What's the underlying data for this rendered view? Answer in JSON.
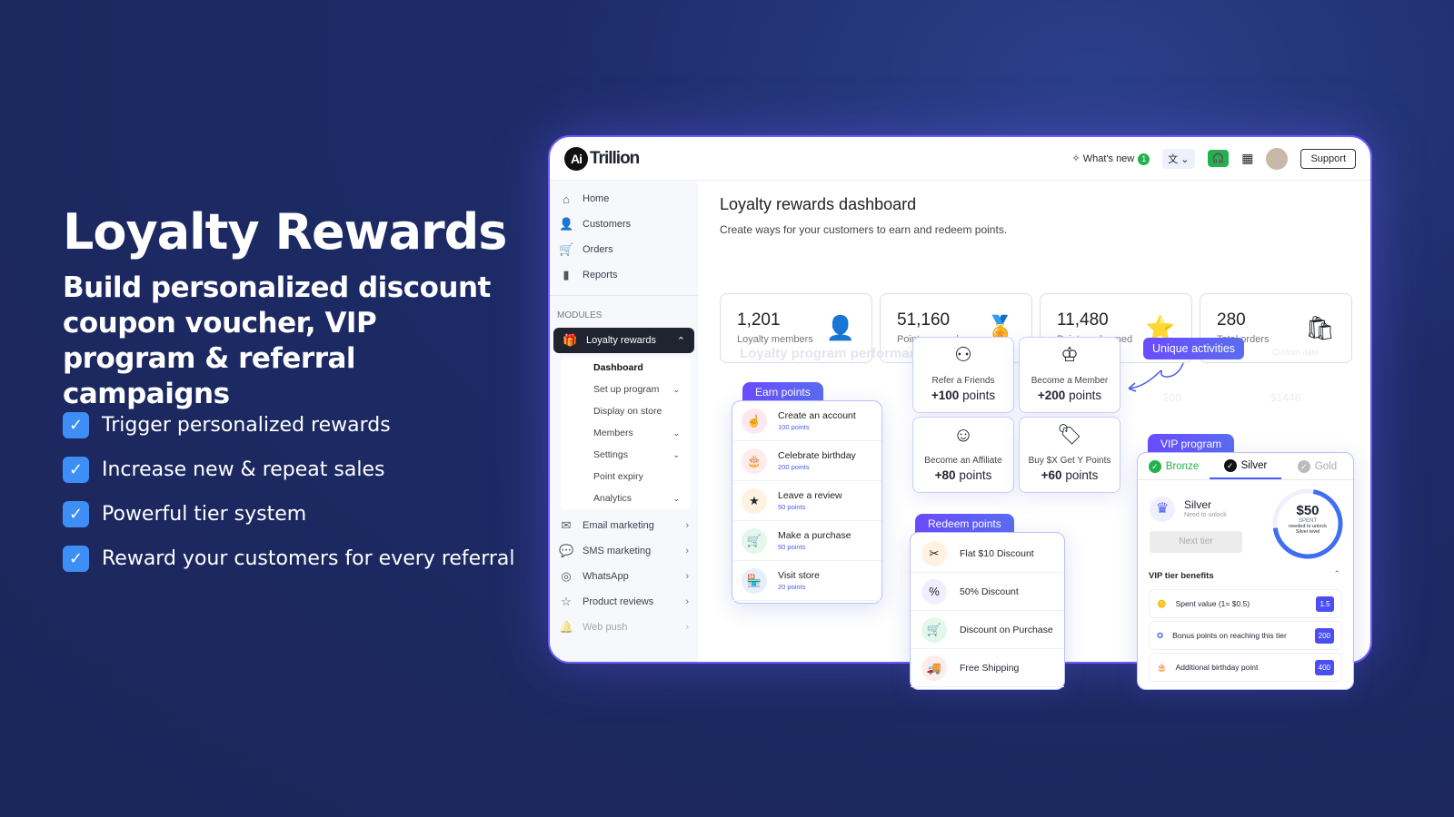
{
  "hero": {
    "title": "Loyalty Rewards",
    "subtitle": "Build personalized discount coupon voucher, VIP program & referral campaigns",
    "features": [
      "Trigger personalized rewards",
      "Increase new & repeat sales",
      "Powerful tier system",
      "Reward your customers for every referral"
    ]
  },
  "app": {
    "logo_mark": "Ai",
    "logo_text": "Trillion",
    "whats_new": "What's new",
    "whats_new_count": "1",
    "support": "Support",
    "colors": {
      "accent": "#6b4cff",
      "background": "#1d2b68",
      "green": "#22b14c"
    }
  },
  "sidebar": {
    "items": [
      {
        "label": "Home",
        "icon": "home-icon"
      },
      {
        "label": "Customers",
        "icon": "user-icon"
      },
      {
        "label": "Orders",
        "icon": "cart-icon"
      },
      {
        "label": "Reports",
        "icon": "bar-chart-icon"
      }
    ],
    "modules_label": "MODULES",
    "active": "Loyalty rewards",
    "sub": [
      {
        "label": "Dashboard",
        "chev": false
      },
      {
        "label": "Set up program",
        "chev": true
      },
      {
        "label": "Display on store",
        "chev": false
      },
      {
        "label": "Members",
        "chev": true
      },
      {
        "label": "Settings",
        "chev": true
      },
      {
        "label": "Point expiry",
        "chev": false
      },
      {
        "label": "Analytics",
        "chev": true
      }
    ],
    "modules": [
      {
        "label": "Email marketing",
        "icon": "mail-icon"
      },
      {
        "label": "SMS marketing",
        "icon": "sms-icon"
      },
      {
        "label": "WhatsApp",
        "icon": "whatsapp-icon"
      },
      {
        "label": "Product reviews",
        "icon": "star-icon"
      },
      {
        "label": "Web push",
        "icon": "bell-icon"
      }
    ]
  },
  "main": {
    "title": "Loyalty rewards dashboard",
    "subtitle": "Create ways for your customers to earn and redeem points.",
    "stats": [
      {
        "value": "1,201",
        "label": "Loyalty members"
      },
      {
        "value": "51,160",
        "label": "Points earned"
      },
      {
        "value": "11,480",
        "label": "Points redeemed"
      },
      {
        "value": "280",
        "label": "Total orders"
      }
    ],
    "faded_title": "Loyalty program performance",
    "faded_date": "Custom date",
    "faded_vals": [
      "200",
      "$1446"
    ]
  },
  "earn": {
    "tag": "Earn points",
    "items": [
      {
        "title": "Create an account",
        "points": "100 points"
      },
      {
        "title": "Celebrate birthday",
        "points": "200 points"
      },
      {
        "title": "Leave a review",
        "points": "50 points"
      },
      {
        "title": "Make a purchase",
        "points": "50 points"
      },
      {
        "title": "Visit store",
        "points": "20 points"
      }
    ]
  },
  "activities": {
    "tag": "Unique activities",
    "items": [
      {
        "title": "Refer a Friends",
        "bold": "+100",
        "rest": " points"
      },
      {
        "title": "Become a Member",
        "bold": "+200",
        "rest": " points"
      },
      {
        "title": "Become an Affiliate",
        "bold": "+80",
        "rest": " points"
      },
      {
        "title": "Buy $X Get Y Points",
        "bold": "+60",
        "rest": " points"
      }
    ]
  },
  "redeem": {
    "tag": "Redeem points",
    "items": [
      "Flat $10 Discount",
      "50% Discount",
      "Discount on Purchase",
      "Free Shipping"
    ]
  },
  "vip": {
    "tag": "VIP program",
    "tabs": [
      "Bronze",
      "Silver",
      "Gold"
    ],
    "tier": "Silver",
    "tier_sub": "Need to unlock",
    "next": "Next tier",
    "ring": {
      "amount": "$50",
      "spent": "SPENT",
      "line1": "needed to unlock",
      "line2": "Silver level",
      "progress": 0.7
    },
    "benefits_title": "VIP tier benefits",
    "benefits": [
      {
        "label": "Spent value (1= $0.5)",
        "value": "1.5"
      },
      {
        "label": "Bonus points on reaching this tier",
        "value": "200"
      },
      {
        "label": "Additional birthday point",
        "value": "400"
      }
    ]
  }
}
